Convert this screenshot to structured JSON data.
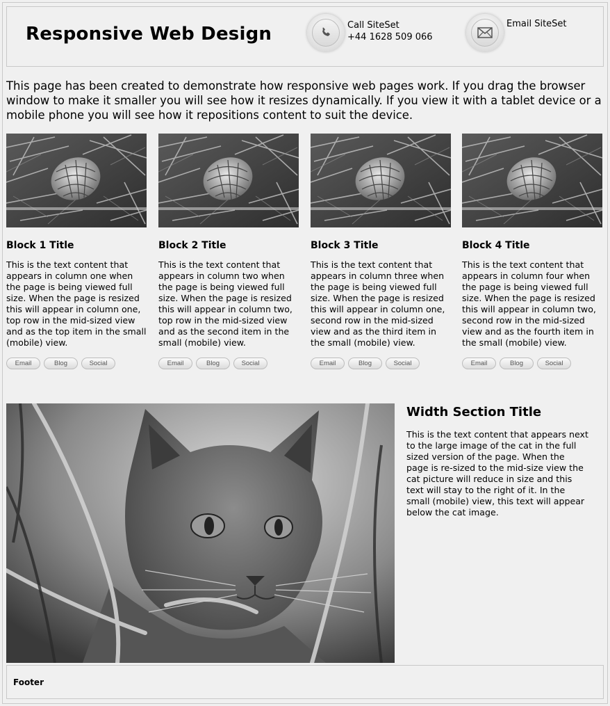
{
  "header": {
    "title": "Responsive Web Design",
    "call": {
      "label": "Call SiteSet",
      "phone": "+44 1628 509 066"
    },
    "email": {
      "label": "Email SiteSet"
    }
  },
  "intro": "This page has been created to demonstrate how responsive web pages work. If you drag the browser window to make it smaller you will see how it resizes dynamically. If you view it with a tablet device or a mobile phone you will see how it repositions content to suit the device.",
  "blocks": [
    {
      "title": "Block 1 Title",
      "text": "This is the text content that appears in column one when the page is being viewed full size. When the page is resized this will appear in column one, top row in the mid-sized view and as the top item in the small (mobile) view.",
      "buttons": [
        "Email",
        "Blog",
        "Social"
      ]
    },
    {
      "title": "Block 2 Title",
      "text": "This is the text content that appears in column two when the page is being viewed full size. When the page is resized this will appear in column two, top row in the mid-sized view and as the second item in the small (mobile) view.",
      "buttons": [
        "Email",
        "Blog",
        "Social"
      ]
    },
    {
      "title": "Block 3 Title",
      "text": "This is the text content that appears in column three when the page is being viewed full size. When the page is resized this will appear in column one, second row in the mid-sized view and as the third item in the small (mobile) view.",
      "buttons": [
        "Email",
        "Blog",
        "Social"
      ]
    },
    {
      "title": "Block 4 Title",
      "text": "This is the text content that appears in column four when the page is being viewed full size. When the page is resized this will appear in column two, second row in the mid-sized view and as the fourth item in the small (mobile) view.",
      "buttons": [
        "Email",
        "Blog",
        "Social"
      ]
    }
  ],
  "width_section": {
    "title": "Width Section Title",
    "text": "This is the text content that appears next to the large image of the cat in the full sized version of the page. When the page is re-sized to the mid-size view the cat picture will reduce in size and this text will stay to the right of it. In the small (mobile) view, this text will appear below the cat image."
  },
  "footer": "Footer",
  "icons": {
    "phone": "phone-icon",
    "email": "envelope-icon"
  }
}
